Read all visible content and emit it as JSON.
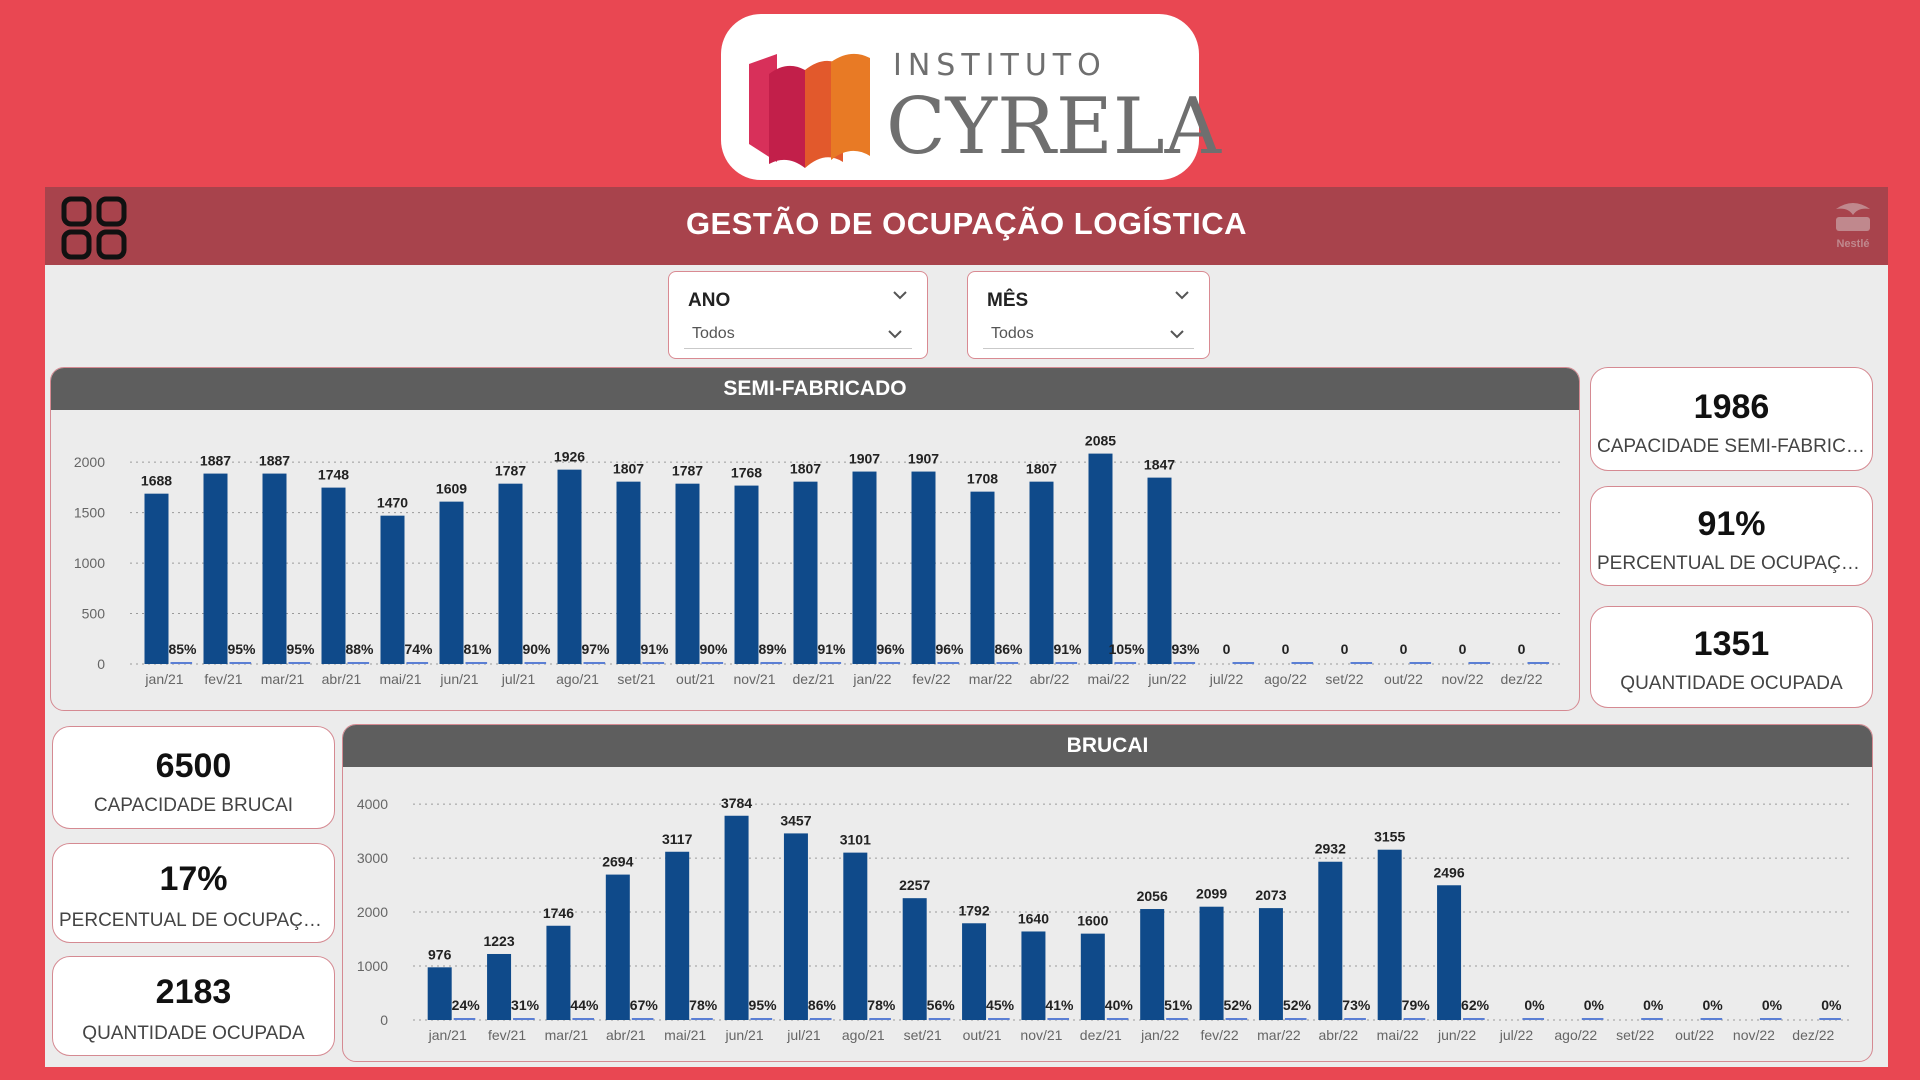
{
  "logo": {
    "line1": "INSTITUTO",
    "line2": "CYRELA"
  },
  "header": {
    "title": "GESTÃO DE OCUPAÇÃO LOGÍSTICA",
    "brand": "Nestlé"
  },
  "filters": {
    "year": {
      "label": "ANO",
      "value": "Todos"
    },
    "month": {
      "label": "MÊS",
      "value": "Todos"
    }
  },
  "kpis_semi": [
    {
      "value": "1986",
      "label": "CAPACIDADE SEMI-FABRICADO"
    },
    {
      "value": "91%",
      "label": "PERCENTUAL DE OCUPAÇÃO"
    },
    {
      "value": "1351",
      "label": "QUANTIDADE OCUPADA"
    }
  ],
  "kpis_brucai": [
    {
      "value": "6500",
      "label": "CAPACIDADE BRUCAI"
    },
    {
      "value": "17%",
      "label": "PERCENTUAL DE OCUPAÇÃO"
    },
    {
      "value": "2183",
      "label": "QUANTIDADE OCUPADA"
    }
  ],
  "colors": {
    "bar": "#0f4a8a",
    "background": "#e94752",
    "header": "#a8434c",
    "chart_header": "#5e5e5e"
  },
  "chart_data": [
    {
      "type": "bar",
      "title": "SEMI-FABRICADO",
      "categories": [
        "jan/21",
        "fev/21",
        "mar/21",
        "abr/21",
        "mai/21",
        "jun/21",
        "jul/21",
        "ago/21",
        "set/21",
        "out/21",
        "nov/21",
        "dez/21",
        "jan/22",
        "fev/22",
        "mar/22",
        "abr/22",
        "mai/22",
        "jun/22",
        "jul/22",
        "ago/22",
        "set/22",
        "out/22",
        "nov/22",
        "dez/22"
      ],
      "values": [
        1688,
        1887,
        1887,
        1748,
        1470,
        1609,
        1787,
        1926,
        1807,
        1787,
        1768,
        1807,
        1907,
        1907,
        1708,
        1807,
        2085,
        1847,
        0,
        0,
        0,
        0,
        0,
        0
      ],
      "percent_labels": [
        "85%",
        "95%",
        "95%",
        "88%",
        "74%",
        "81%",
        "90%",
        "97%",
        "91%",
        "90%",
        "89%",
        "91%",
        "96%",
        "96%",
        "86%",
        "91%",
        "105%",
        "93%",
        "",
        "",
        "",
        "",
        "",
        ""
      ],
      "value_labels": [
        "1688",
        "1887",
        "1887",
        "1748",
        "1470",
        "1609",
        "1787",
        "1926",
        "1807",
        "1787",
        "1768",
        "1807",
        "1907",
        "1907",
        "1708",
        "1807",
        "2085",
        "1847",
        "0",
        "0",
        "0",
        "0",
        "0",
        "0"
      ],
      "yticks": [
        "0",
        "500",
        "1000",
        "1500",
        "2000"
      ],
      "ylim": [
        0,
        2200
      ],
      "grid": true
    },
    {
      "type": "bar",
      "title": "BRUCAI",
      "categories": [
        "jan/21",
        "fev/21",
        "mar/21",
        "abr/21",
        "mai/21",
        "jun/21",
        "jul/21",
        "ago/21",
        "set/21",
        "out/21",
        "nov/21",
        "dez/21",
        "jan/22",
        "fev/22",
        "mar/22",
        "abr/22",
        "mai/22",
        "jun/22",
        "jul/22",
        "ago/22",
        "set/22",
        "out/22",
        "nov/22",
        "dez/22"
      ],
      "values": [
        976,
        1223,
        1746,
        2694,
        3117,
        3784,
        3457,
        3101,
        2257,
        1792,
        1640,
        1600,
        2056,
        2099,
        2073,
        2932,
        3155,
        2496,
        0,
        0,
        0,
        0,
        0,
        0
      ],
      "percent_labels": [
        "24%",
        "31%",
        "44%",
        "67%",
        "78%",
        "95%",
        "86%",
        "78%",
        "56%",
        "45%",
        "41%",
        "40%",
        "51%",
        "52%",
        "52%",
        "73%",
        "79%",
        "62%",
        "0%",
        "0%",
        "0%",
        "0%",
        "0%",
        "0%"
      ],
      "value_labels": [
        "976",
        "1223",
        "1746",
        "2694",
        "3117",
        "3784",
        "3457",
        "3101",
        "2257",
        "1792",
        "1640",
        "1600",
        "2056",
        "2099",
        "2073",
        "2932",
        "3155",
        "2496",
        "",
        "",
        "",
        "",
        "",
        ""
      ],
      "yticks": [
        "0",
        "1000",
        "2000",
        "3000",
        "4000"
      ],
      "ylim": [
        0,
        4150
      ],
      "grid": true
    }
  ]
}
